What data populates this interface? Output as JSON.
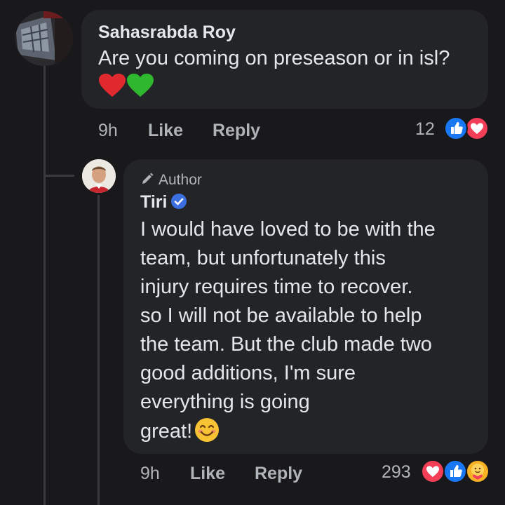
{
  "comment": {
    "author": "Sahasrabda Roy",
    "text": "Are you coming on preseason or in isl?",
    "time": "9h",
    "like_label": "Like",
    "reply_label": "Reply",
    "reaction_count": "12",
    "reactions": [
      "like-icon",
      "love-icon"
    ],
    "emojis": [
      "red-heart-emoji",
      "green-heart-emoji"
    ]
  },
  "reply": {
    "badge": "Author",
    "author": "Tiri",
    "verified": true,
    "text_lines": [
      "I would have loved to be with the",
      "team, but unfortunately this",
      "injury requires time to recover.",
      "so I will not be available to help",
      "the team. But the club made two",
      "good additions, I'm sure",
      "everything is going",
      "great!"
    ],
    "emoji": "smiling-face-emoji",
    "time": "9h",
    "like_label": "Like",
    "reply_label": "Reply",
    "reaction_count": "293",
    "reactions": [
      "love-icon",
      "like-icon",
      "care-icon"
    ]
  },
  "colors": {
    "background": "#19191b",
    "bubble": "#232427",
    "like_blue": "#1877f2",
    "love_red": "#f33e58",
    "verified_blue": "#3b6fe0"
  }
}
